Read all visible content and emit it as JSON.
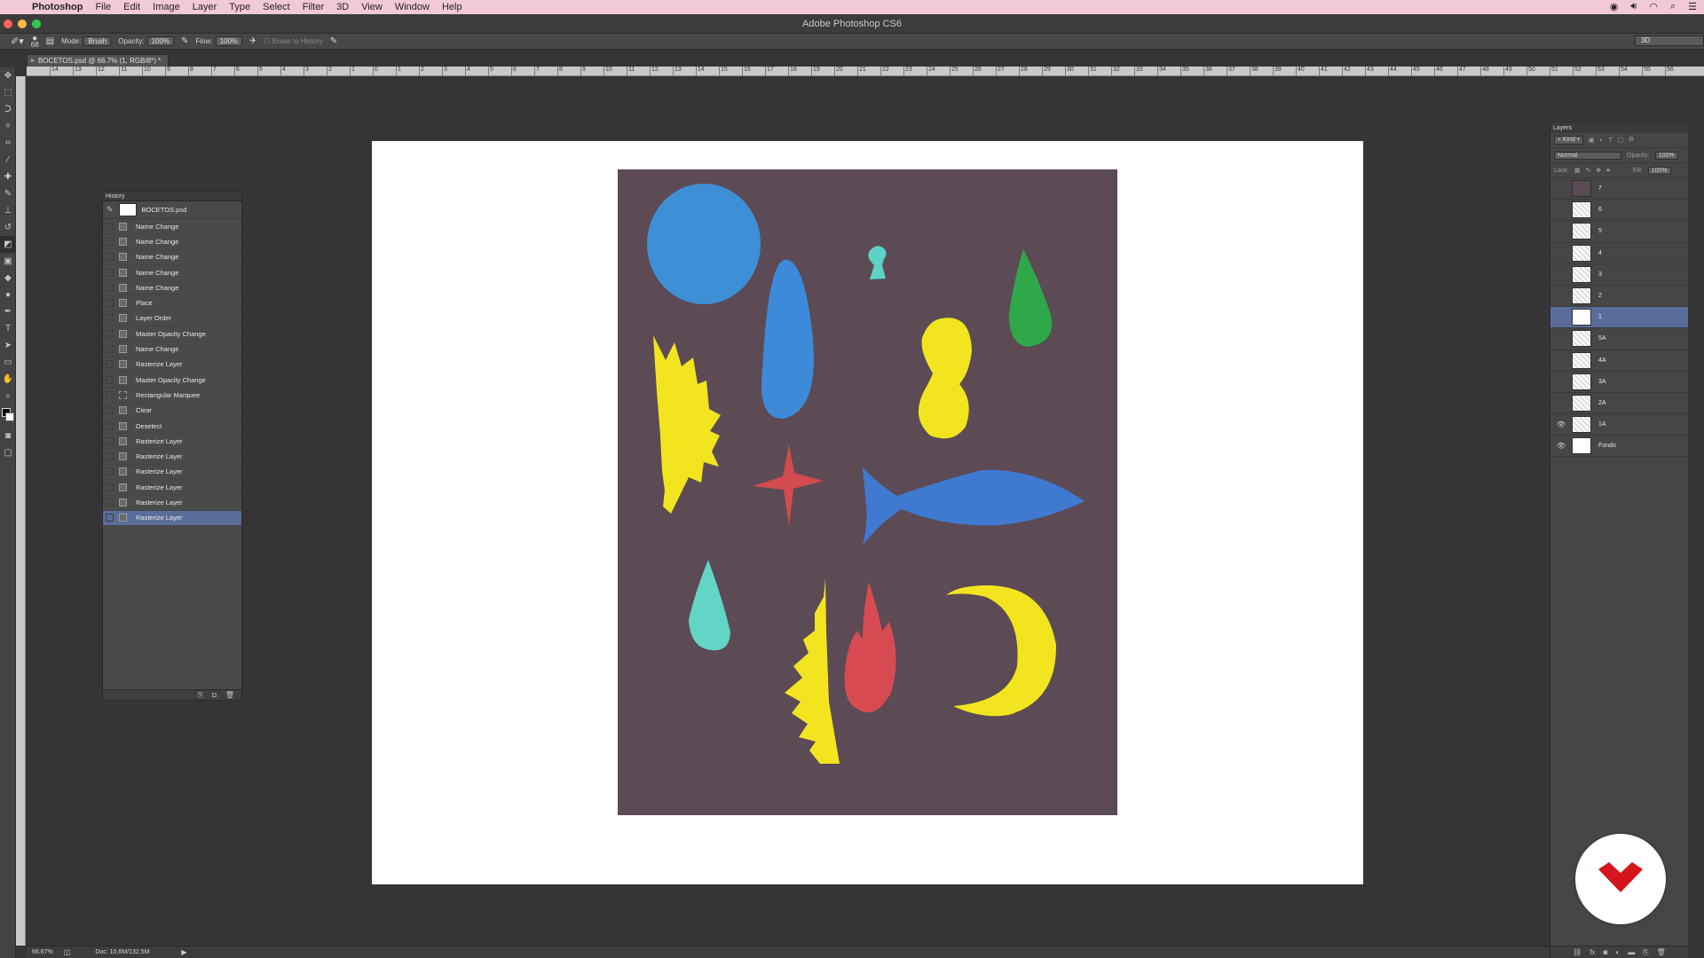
{
  "menubar": {
    "app": "Photoshop",
    "items": [
      "File",
      "Edit",
      "Image",
      "Layer",
      "Type",
      "Select",
      "Filter",
      "3D",
      "View",
      "Window",
      "Help"
    ]
  },
  "window": {
    "title": "Adobe Photoshop CS6"
  },
  "options": {
    "brush_size": "68",
    "mode_label": "Mode:",
    "mode_value": "Brush",
    "opacity_label": "Opacity:",
    "opacity_value": "100%",
    "flow_label": "Flow:",
    "flow_value": "100%",
    "erase_to_history": "Erase to History",
    "workspace": "3D"
  },
  "document": {
    "tab_title": "BOCETOS.psd @ 66.7% (1, RGB/8*) *",
    "zoom": "66.67%",
    "doc_size": "Doc: 10.6M/132.5M"
  },
  "ruler": {
    "labels": [
      "14",
      "13",
      "12",
      "11",
      "10",
      "9",
      "8",
      "7",
      "6",
      "5",
      "4",
      "3",
      "2",
      "1",
      "0",
      "1",
      "2",
      "3",
      "4",
      "5",
      "6",
      "7",
      "8",
      "9",
      "10",
      "11",
      "12",
      "13",
      "14",
      "15",
      "16",
      "17",
      "18",
      "19",
      "20",
      "21",
      "22",
      "23",
      "24",
      "25",
      "26",
      "27",
      "28",
      "29",
      "30",
      "31",
      "32",
      "33",
      "34",
      "35",
      "36",
      "37",
      "38",
      "39",
      "40",
      "41",
      "42",
      "43",
      "44",
      "45",
      "46",
      "47",
      "48",
      "49",
      "50",
      "51",
      "52",
      "53",
      "54",
      "55",
      "56"
    ]
  },
  "history": {
    "title": "History",
    "snapshot": "BOCETOS.psd",
    "states": [
      "Name Change",
      "Name Change",
      "Name Change",
      "Name Change",
      "Name Change",
      "Place",
      "Layer Order",
      "Master Opacity Change",
      "Name Change",
      "Rasterize Layer",
      "Master Opacity Change",
      "Rectangular Marquee",
      "Clear",
      "Deselect",
      "Rasterize Layer",
      "Rasterize Layer",
      "Rasterize Layer",
      "Rasterize Layer",
      "Rasterize Layer",
      "Rasterize Layer"
    ]
  },
  "layers": {
    "title": "Layers",
    "kind_label": "Kind",
    "blend_mode": "Normal",
    "opacity_label": "Opacity:",
    "opacity_value": "100%",
    "lock_label": "Lock:",
    "fill_label": "Fill:",
    "fill_value": "100%",
    "items": [
      {
        "name": "7"
      },
      {
        "name": "6"
      },
      {
        "name": "5"
      },
      {
        "name": "4"
      },
      {
        "name": "3"
      },
      {
        "name": "2"
      },
      {
        "name": "1"
      },
      {
        "name": "5A"
      },
      {
        "name": "4A"
      },
      {
        "name": "3A"
      },
      {
        "name": "2A"
      },
      {
        "name": "1A"
      },
      {
        "name": "Fondo"
      }
    ]
  },
  "colors": {
    "menubar_bg": "#f2c9d6",
    "selection": "#5a6d9a",
    "artwork_bg": "#5c4a55",
    "badge_red": "#d4151b"
  }
}
